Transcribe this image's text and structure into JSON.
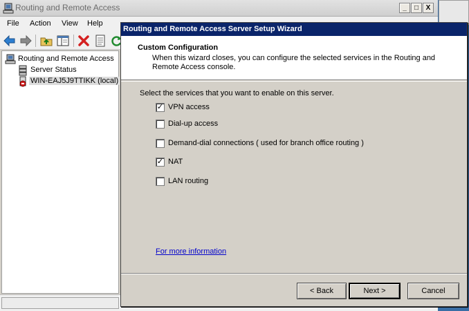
{
  "main_window": {
    "title": "Routing and Remote Access",
    "caption_buttons": {
      "minimize": "_",
      "maximize": "□",
      "close": "X"
    },
    "menu": [
      "File",
      "Action",
      "View",
      "Help"
    ],
    "toolbar_icons": [
      "back-arrow-icon",
      "forward-arrow-icon",
      "up-folder-icon",
      "show-hide-tree-icon",
      "delete-icon",
      "properties-icon",
      "refresh-icon"
    ],
    "tree": {
      "root": "Routing and Remote Access",
      "children": [
        "Server Status",
        "WIN-EAJ5J9TTIKK (local)"
      ]
    }
  },
  "wizard": {
    "title": "Routing and Remote Access Server Setup Wizard",
    "header_title": "Custom Configuration",
    "header_description": "When this wizard closes, you can configure the selected services in the Routing and Remote Access console.",
    "instruction": "Select the services that you want to enable on this server.",
    "services": [
      {
        "label": "VPN access",
        "checked": true,
        "mark": "✓"
      },
      {
        "label": "Dial-up access",
        "checked": false,
        "mark": ""
      },
      {
        "label": "Demand-dial connections ( used for branch office routing )",
        "checked": false,
        "mark": ""
      },
      {
        "label": "NAT",
        "checked": true,
        "mark": "✓"
      },
      {
        "label": "LAN routing",
        "checked": false,
        "mark": ""
      }
    ],
    "more_info_link": "For more information",
    "buttons": {
      "back": "< Back",
      "next": "Next >",
      "cancel": "Cancel"
    }
  },
  "colors": {
    "wizard_title_bg": "#0a246a",
    "dialog_face": "#d4d0c8",
    "desktop": "#3a6ea5",
    "link": "#0000cc"
  }
}
